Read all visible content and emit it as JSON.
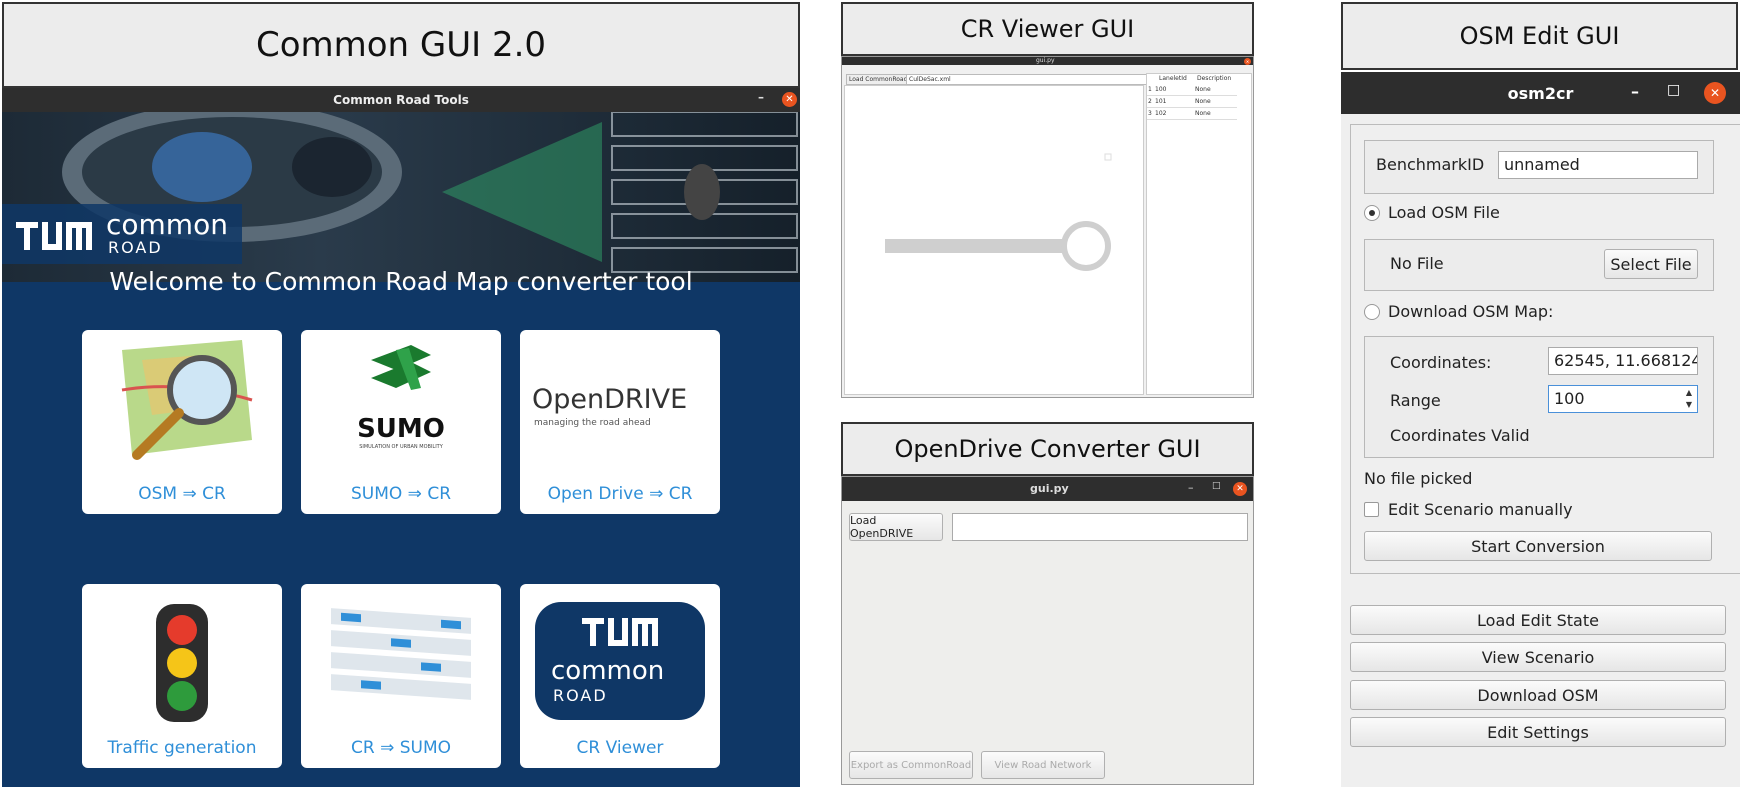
{
  "captions": {
    "common": "Common GUI 2.0",
    "viewer": "CR Viewer GUI",
    "opendrive": "OpenDrive Converter GUI",
    "osm": "OSM Edit GUI"
  },
  "common_gui": {
    "window_title": "Common Road Tools",
    "logo_text_1": "common",
    "logo_text_2": "ROAD",
    "welcome": "Welcome to Common Road Map converter tool",
    "tiles": [
      {
        "label": "OSM ⇒ CR"
      },
      {
        "label": "SUMO ⇒ CR",
        "logo": "SUMO",
        "logo_sub": "SIMULATION OF URBAN MOBILITY"
      },
      {
        "label": "Open Drive ⇒ CR",
        "logo": "OpenDRIVE",
        "logo_sub": "managing the road ahead"
      },
      {
        "label": "Traffic generation"
      },
      {
        "label": "CR ⇒ SUMO"
      },
      {
        "label": "CR Viewer",
        "logo_text_1": "common",
        "logo_text_2": "ROAD"
      }
    ],
    "colors": {
      "accent": "#2f8fd8",
      "background": "#0f3766",
      "close": "#e95420"
    }
  },
  "cr_viewer": {
    "window_title": "gui.py",
    "load_button": "Load CommonRoad",
    "file_field": "CulDeSac.xml",
    "table_headers": [
      "LaneletId",
      "Description"
    ],
    "rows": [
      {
        "index": "1",
        "id": "100",
        "desc": "None"
      },
      {
        "index": "2",
        "id": "101",
        "desc": "None"
      },
      {
        "index": "3",
        "id": "102",
        "desc": "None"
      }
    ]
  },
  "opendrive_gui": {
    "window_title": "gui.py",
    "load_button": "Load OpenDRIVE",
    "path_value": "",
    "export_button": "Export as CommonRoad",
    "view_button": "View Road Network"
  },
  "osm_gui": {
    "window_title": "osm2cr",
    "benchmark_label": "BenchmarkID",
    "benchmark_value": "unnamed",
    "load_osm_label": "Load OSM File",
    "no_file_label": "No File",
    "select_file_button": "Select File",
    "download_label": "Download OSM Map:",
    "coordinates_label": "Coordinates:",
    "coordinates_value": "62545, 11.668124",
    "range_label": "Range",
    "range_value": "100",
    "coords_valid": "Coordinates Valid",
    "no_file_picked": "No file picked",
    "edit_manually": "Edit Scenario manually",
    "start_conversion": "Start Conversion",
    "load_edit_state": "Load Edit State",
    "view_scenario": "View Scenario",
    "download_osm": "Download OSM",
    "edit_settings": "Edit Settings"
  }
}
